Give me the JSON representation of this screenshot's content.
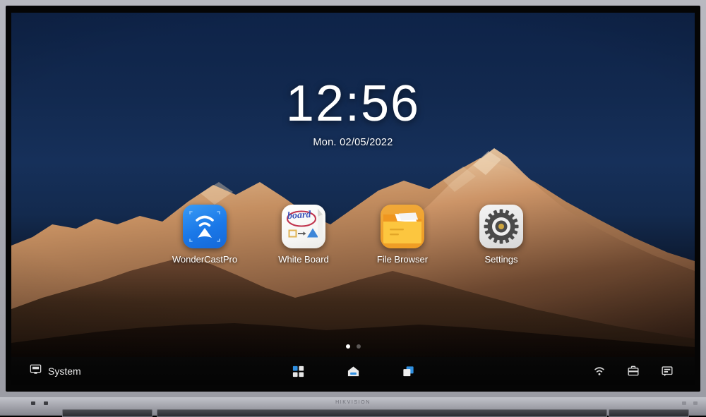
{
  "device": {
    "brand": "HIKVISION",
    "type": "interactive-flat-panel"
  },
  "screen": {
    "clock": {
      "time": "12:56",
      "date": "Mon. 02/05/2022"
    },
    "wallpaper": {
      "description": "snow-capped mountain range at dusk",
      "sky_color": "#132a4e",
      "peak_light_color": "#c8885a",
      "shadow_color": "#1a0e08"
    },
    "apps": [
      {
        "label": "WonderCastPro",
        "icon": "cast-icon",
        "accent": "#2080ee"
      },
      {
        "label": "White Board",
        "icon": "whiteboard-icon",
        "accent": "#ffffff",
        "word": "board"
      },
      {
        "label": "File Browser",
        "icon": "folder-icon",
        "accent": "#f0a93a"
      },
      {
        "label": "Settings",
        "icon": "gear-icon",
        "accent": "#e4e4e4"
      }
    ],
    "pager": {
      "total": 2,
      "active_index": 0
    },
    "taskbar": {
      "system_label": "System",
      "system_icon": "monitor-icon",
      "center_buttons": [
        {
          "name": "apps-grid-icon",
          "label": "Apps"
        },
        {
          "name": "home-icon",
          "label": "Home"
        },
        {
          "name": "recents-icon",
          "label": "Recents"
        }
      ],
      "right_buttons": [
        {
          "name": "wifi-icon",
          "label": "Wi-Fi"
        },
        {
          "name": "toolbox-icon",
          "label": "Tools"
        },
        {
          "name": "message-icon",
          "label": "Messages"
        }
      ]
    }
  }
}
